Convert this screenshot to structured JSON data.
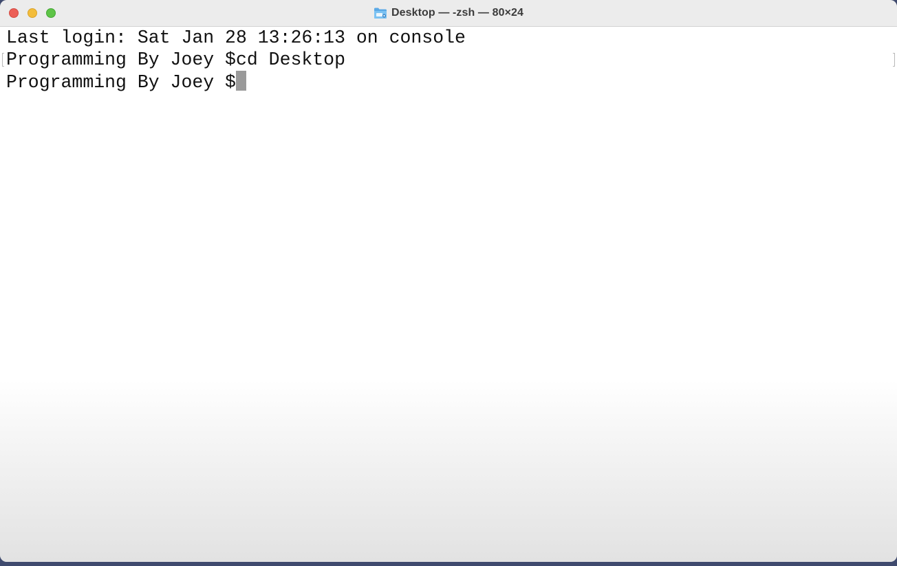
{
  "window": {
    "title": "Desktop — -zsh — 80×24",
    "title_icon": "folder-icon"
  },
  "controls": {
    "close": "close-button",
    "minimize": "minimize-button",
    "zoom": "zoom-button"
  },
  "terminal": {
    "lines": [
      "Last login: Sat Jan 28 13:26:13 on console",
      "Programming By Joey $cd Desktop",
      "Programming By Joey $"
    ],
    "cursor_color": "#9a9a9a"
  },
  "colors": {
    "close": "#ec5f57",
    "minimize": "#f3bd3b",
    "zoom": "#5ec447",
    "titlebar": "#ececec",
    "background": "#ffffff",
    "text": "#111111"
  }
}
